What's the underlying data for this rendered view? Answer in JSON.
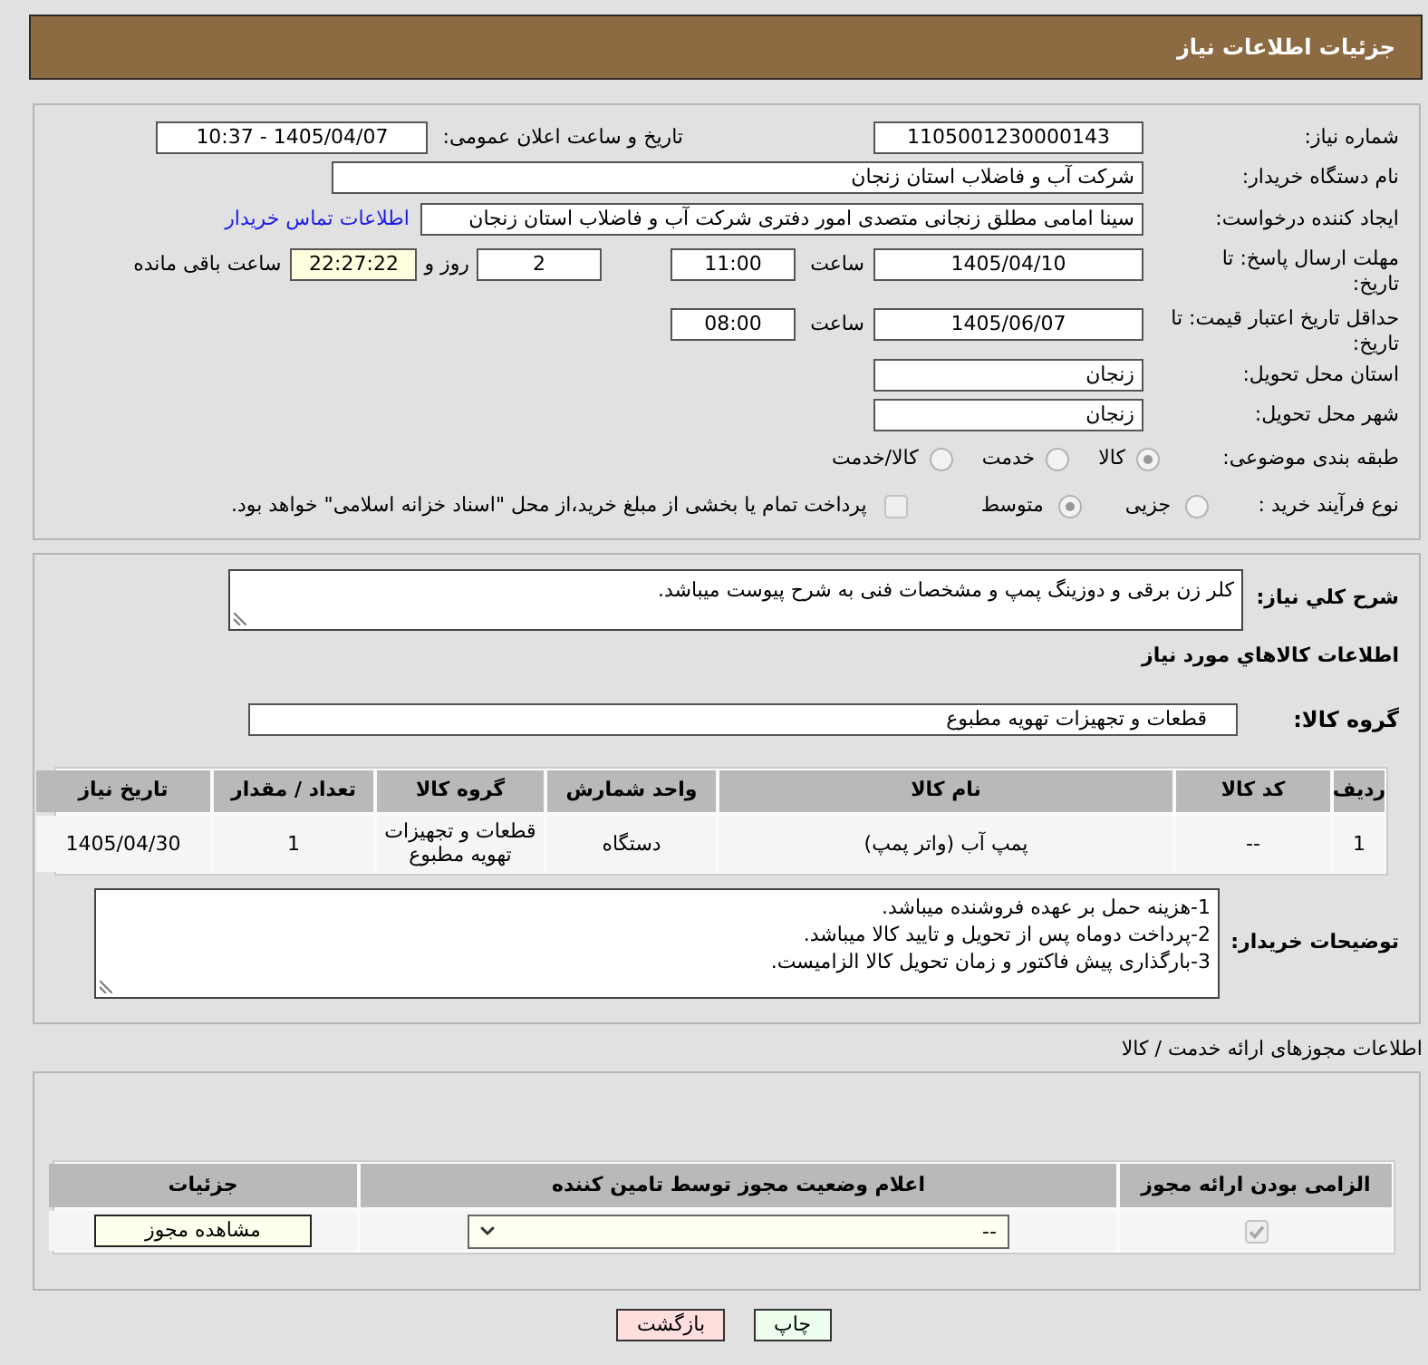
{
  "header": {
    "title": "جزئیات اطلاعات نیاز"
  },
  "need_info": {
    "need_number": {
      "label": "شماره نیاز:",
      "value": "1105001230000143"
    },
    "announce_datetime": {
      "label": "تاریخ و ساعت اعلان عمومی:",
      "value": "1405/04/07 - 10:37"
    },
    "buyer_org": {
      "label": "نام دستگاه خریدار:",
      "value": "شرکت آب و فاضلاب استان زنجان"
    },
    "requester": {
      "label": "ایجاد کننده درخواست:",
      "value": "سینا امامی مطلق زنجانی متصدی امور دفتری شرکت آب و فاضلاب استان زنجان",
      "contact_link": "اطلاعات تماس خریدار"
    },
    "reply_deadline": {
      "label": "مهلت ارسال پاسخ: تا تاریخ:",
      "date": "1405/04/10",
      "time_label": "ساعت",
      "time": "11:00",
      "days": "2",
      "days_label": "روز و",
      "remaining": "22:27:22",
      "remaining_label": "ساعت باقی مانده"
    },
    "price_validity": {
      "label": "حداقل تاریخ اعتبار قیمت: تا تاریخ:",
      "date": "1405/06/07",
      "time_label": "ساعت",
      "time": "08:00"
    },
    "delivery_province": {
      "label": "استان محل تحویل:",
      "value": "زنجان"
    },
    "delivery_city": {
      "label": "شهر محل تحویل:",
      "value": "زنجان"
    },
    "category": {
      "label": "طبقه بندی موضوعی:",
      "options": [
        {
          "label": "کالا",
          "selected": true
        },
        {
          "label": "خدمت",
          "selected": false
        },
        {
          "label": "کالا/خدمت",
          "selected": false
        }
      ]
    },
    "purchase_process": {
      "label": "نوع فرآیند خرید :",
      "options": [
        {
          "label": "جزیی",
          "selected": false
        },
        {
          "label": "متوسط",
          "selected": true
        }
      ],
      "treasury_payment": {
        "label": "پرداخت تمام یا بخشی از مبلغ خرید،از محل \"اسناد خزانه اسلامی\" خواهد بود.",
        "checked": false
      }
    }
  },
  "goods": {
    "description": {
      "label": "شرح کلي نياز:",
      "value": "کلر زن برقی و دوزینگ پمپ و مشخصات فنی به شرح پیوست میباشد."
    },
    "section_title": "اطلاعات کالاهاي مورد نياز",
    "group": {
      "label": "گروه کالا:",
      "value": "قطعات و تجهیزات تهویه مطبوع"
    },
    "table": {
      "columns": [
        "ردیف",
        "کد کالا",
        "نام کالا",
        "واحد شمارش",
        "گروه کالا",
        "تعداد / مقدار",
        "تاریخ نیاز"
      ],
      "rows": [
        [
          "1",
          "--",
          "پمپ آب (واتر پمپ)",
          "دستگاه",
          "قطعات و تجهیزات تهویه مطبوع",
          "1",
          "1405/04/30"
        ]
      ]
    },
    "buyer_notes": {
      "label": "توضیحات خریدار:",
      "lines": [
        "1-هزینه حمل بر عهده فروشنده میباشد.",
        "2-پرداخت دوماه پس از تحویل و تایید کالا میباشد.",
        "3-بارگذاری پیش فاکتور و زمان تحویل کالا الزامیست."
      ]
    }
  },
  "licenses": {
    "title": "اطلاعات مجوزهای ارائه خدمت / کالا",
    "table": {
      "columns": [
        "الزامی بودن ارائه مجوز",
        "اعلام وضعیت مجوز توسط تامین کننده",
        "جزئیات"
      ],
      "rows": [
        {
          "required": true,
          "status": "--",
          "details_button": "مشاهده مجوز"
        }
      ]
    }
  },
  "buttons": [
    {
      "label": "چاپ",
      "kind": "print"
    },
    {
      "label": "بازگشت",
      "kind": "back"
    }
  ]
}
